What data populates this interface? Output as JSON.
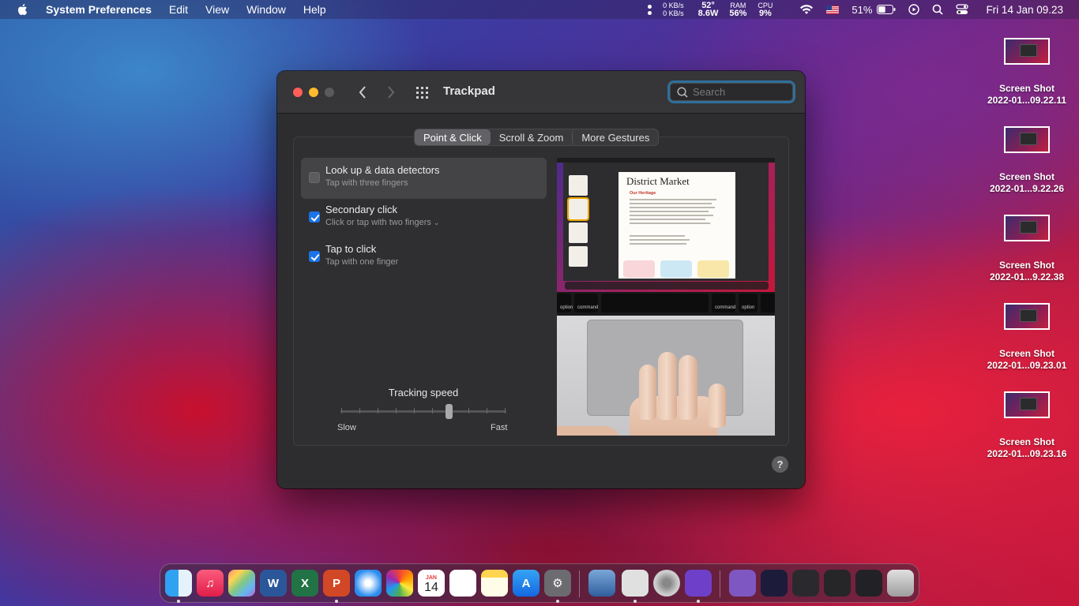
{
  "menubar": {
    "app_name": "System Preferences",
    "menus": [
      "Edit",
      "View",
      "Window",
      "Help"
    ],
    "net_up": "0 KB/s",
    "net_down": "0 KB/s",
    "temp": "52°",
    "power": "8.6W",
    "ram_label": "RAM",
    "ram_value": "56%",
    "cpu_label": "CPU",
    "cpu_value": "9%",
    "battery": "51%",
    "battery_level": 0.51,
    "clock": "Fri 14 Jan  09.23"
  },
  "window": {
    "title": "Trackpad",
    "search_placeholder": "Search",
    "tabs": [
      "Point & Click",
      "Scroll & Zoom",
      "More Gestures"
    ],
    "active_tab": "Point & Click",
    "options": [
      {
        "title": "Look up & data detectors",
        "subtitle": "Tap with three fingers",
        "checked": false
      },
      {
        "title": "Secondary click",
        "subtitle": "Click or tap with two fingers",
        "checked": true
      },
      {
        "title": "Tap to click",
        "subtitle": "Tap with one finger",
        "checked": true
      }
    ],
    "tracking": {
      "title": "Tracking speed",
      "min_label": "Slow",
      "max_label": "Fast",
      "position_fraction": 0.66
    },
    "help_label": "?",
    "preview": {
      "doc_title": "District Market",
      "doc_heading": "Our Heritage",
      "key_option": "option",
      "key_command": "command",
      "key_cmd_symbol": "⌘",
      "key_opt_symbol": "⌥"
    }
  },
  "desktop": {
    "files": [
      {
        "line1": "Screen Shot",
        "line2": "2022-01...09.22.11"
      },
      {
        "line1": "Screen Shot",
        "line2": "2022-01...9.22.26"
      },
      {
        "line1": "Screen Shot",
        "line2": "2022-01...9.22.38"
      },
      {
        "line1": "Screen Shot",
        "line2": "2022-01...09.23.01"
      },
      {
        "line1": "Screen Shot",
        "line2": "2022-01...09.23.16"
      }
    ]
  },
  "dock": {
    "calendar_month": "JAN",
    "calendar_day": "14",
    "word_letter": "W",
    "excel_letter": "X",
    "powerpoint_letter": "P"
  },
  "colors": {
    "accent": "#1a73e8",
    "close": "#ff5f57",
    "minimize": "#febc2e",
    "window_bg": "#2d2d2f"
  }
}
